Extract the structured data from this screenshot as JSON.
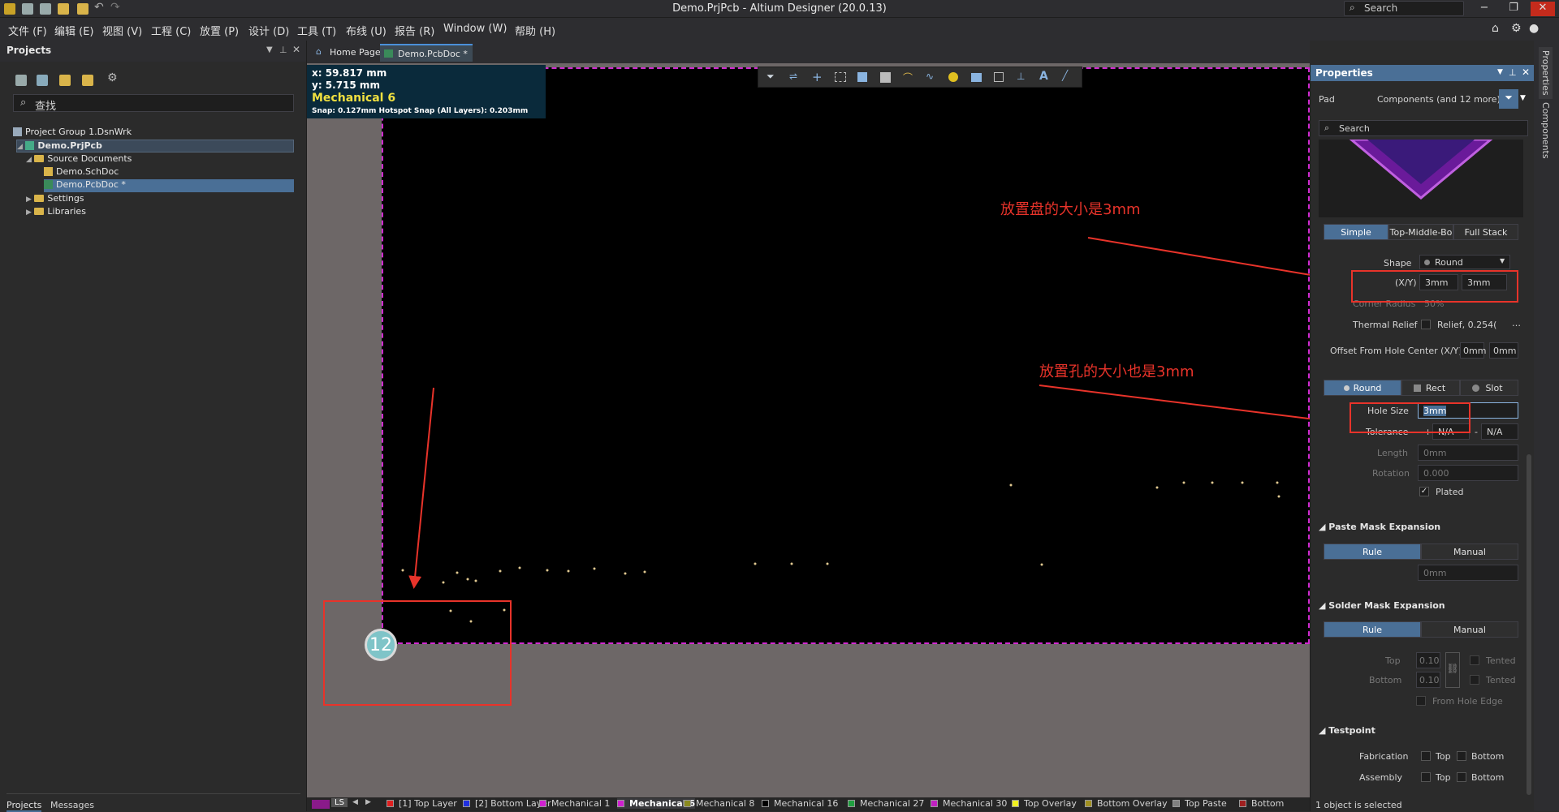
{
  "window": {
    "title": "Demo.PrjPcb - Altium Designer (20.0.13)",
    "search_placeholder": "Search",
    "min": "−",
    "max": "❐",
    "close": "✕"
  },
  "menu": [
    "文件 (F)",
    "编辑 (E)",
    "视图 (V)",
    "工程 (C)",
    "放置 (P)",
    "设计 (D)",
    "工具 (T)",
    "布线 (U)",
    "报告 (R)",
    "Window (W)",
    "帮助 (H)"
  ],
  "left_panel": {
    "title": "Projects",
    "search_placeholder": "查找",
    "tree": [
      {
        "label": "Project Group 1.DsnWrk"
      },
      {
        "label": "Demo.PrjPcb"
      },
      {
        "label": "Source Documents"
      },
      {
        "label": "Demo.SchDoc"
      },
      {
        "label": "Demo.PcbDoc *"
      },
      {
        "label": "Settings"
      },
      {
        "label": "Libraries"
      }
    ],
    "bottom_tabs": [
      "Projects",
      "Messages"
    ]
  },
  "doc_tabs": [
    "Home Page",
    "Demo.PcbDoc *"
  ],
  "coords": {
    "x": "x: 59.817 mm",
    "y": "y:  5.715  mm",
    "layer": "Mechanical 6",
    "snap": "Snap: 0.127mm Hotspot Snap (All Layers): 0.203mm"
  },
  "pad_badge": "12",
  "annotations": {
    "pad_size": "放置盘的大小是3mm",
    "hole_size": "放置孔的大小也是3mm"
  },
  "properties": {
    "title": "Properties",
    "object_type": "Pad",
    "filter_label": "Components (and 12 more)",
    "search_placeholder": "Search",
    "stack_tabs": [
      "Simple",
      "Top-Middle-Bo",
      "Full Stack"
    ],
    "shape_label": "Shape",
    "shape_value": "Round",
    "xy_label": "(X/Y)",
    "x": "3mm",
    "y": "3mm",
    "corner_label": "Corner Radius",
    "corner_value": "50%",
    "thermal_label": "Thermal Relief",
    "thermal_value": "Relief, 0.254(",
    "offset_label": "Offset From Hole Center (X/Y)",
    "offset_x": "0mm",
    "offset_y": "0mm",
    "hole_tabs": [
      "Round",
      "Rect",
      "Slot"
    ],
    "hole_size_label": "Hole Size",
    "hole_size_value": "3mm",
    "tolerance_label": "Tolerance",
    "tol_plus": "+",
    "tol_plus_val": "N/A",
    "tol_minus": "-",
    "tol_minus_val": "N/A",
    "length_label": "Length",
    "length_value": "0mm",
    "rotation_label": "Rotation",
    "rotation_value": "0.000",
    "plated_label": "Plated",
    "paste_title": "Paste Mask Expansion",
    "paste_tabs": [
      "Rule",
      "Manual"
    ],
    "paste_value": "0mm",
    "solder_title": "Solder Mask Expansion",
    "solder_tabs": [
      "Rule",
      "Manual"
    ],
    "top_label": "Top",
    "top_value": "0.10",
    "bottom_label": "Bottom",
    "bottom_value": "0.10",
    "tented1": "Tented",
    "tented2": "Tented",
    "from_hole_edge": "From Hole Edge",
    "testpoint_title": "Testpoint",
    "fabrication_label": "Fabrication",
    "assembly_label": "Assembly",
    "tp_top": "Top",
    "tp_bottom": "Bottom",
    "status": "1 object is selected"
  },
  "vertical_tabs": [
    "Properties",
    "Components"
  ],
  "layers": [
    {
      "name": "[1] Top Layer",
      "color": "#e02020"
    },
    {
      "name": "[2] Bottom Layer",
      "color": "#2030e0"
    },
    {
      "name": "Mechanical 1",
      "color": "#d020d0"
    },
    {
      "name": "Mechanical 6",
      "color": "#d020d0"
    },
    {
      "name": "Mechanical 8",
      "color": "#8a8a20"
    },
    {
      "name": "Mechanical 16",
      "color": "#000000"
    },
    {
      "name": "Mechanical 27",
      "color": "#20a040"
    },
    {
      "name": "Mechanical 30",
      "color": "#c020c0"
    },
    {
      "name": "Top Overlay",
      "color": "#f0f020"
    },
    {
      "name": "Bottom Overlay",
      "color": "#a09020"
    },
    {
      "name": "Top Paste",
      "color": "#808080"
    },
    {
      "name": "Bottom",
      "color": "#a02020"
    }
  ],
  "ls_label": "LS"
}
